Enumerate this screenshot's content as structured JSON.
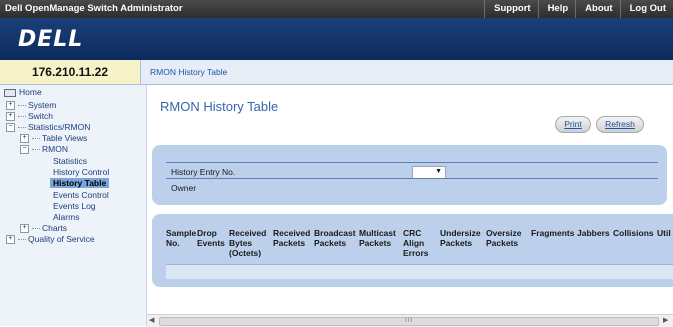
{
  "topbar": {
    "app_title": "Dell OpenManage Switch Administrator",
    "links": [
      "Support",
      "Help",
      "About",
      "Log Out"
    ]
  },
  "brand": {
    "logo_text": "DELL"
  },
  "addressbar": {
    "ip": "176.210.11.22",
    "breadcrumb": "RMON History Table"
  },
  "nav": {
    "home": "Home",
    "system": "System",
    "switch": "Switch",
    "stats_rmon": "Statistics/RMON",
    "table_views": "Table Views",
    "rmon": "RMON",
    "statistics": "Statistics",
    "history_control": "History Control",
    "history_table": "History Table",
    "events_control": "Events Control",
    "events_log": "Events Log",
    "alarms": "Alarms",
    "charts": "Charts",
    "qos": "Quality of Service"
  },
  "main": {
    "title": "RMON History Table",
    "print_label": "Print",
    "refresh_label": "Refresh",
    "form": {
      "entry_label": "History Entry No.",
      "owner_label": "Owner",
      "entry_value": ""
    },
    "table": {
      "columns": [
        "Sample\nNo.",
        "Drop\nEvents",
        "Received\nBytes\n(Octets)",
        "Received\nPackets",
        "Broadcast\nPackets",
        "Multicast\nPackets",
        "CRC\nAlign\nErrors",
        "Undersize\nPackets",
        "Oversize\nPackets",
        "Fragments",
        "Jabbers",
        "Collisions",
        "Util"
      ]
    },
    "scrollbar_grip": "III"
  }
}
